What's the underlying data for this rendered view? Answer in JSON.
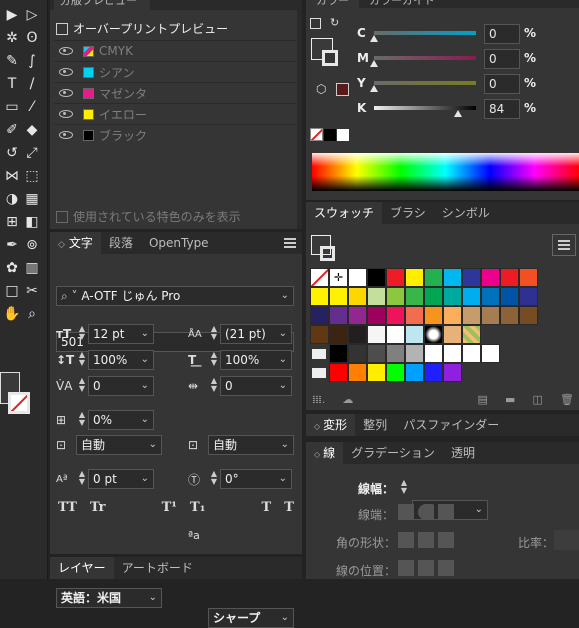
{
  "toolbar": {
    "tools": [
      "selection-tool",
      "direct-selection-tool",
      "magic-wand-tool",
      "lasso-tool",
      "pen-tool",
      "curvature-tool",
      "type-tool",
      "line-tool",
      "rectangle-tool",
      "paintbrush-tool",
      "shaper-tool",
      "eraser-tool",
      "rotate-tool",
      "scale-tool",
      "width-tool",
      "free-transform-tool",
      "shape-builder-tool",
      "perspective-grid-tool",
      "mesh-tool",
      "gradient-tool",
      "eyedropper-tool",
      "blend-tool",
      "symbol-sprayer-tool",
      "column-graph-tool",
      "artboard-tool",
      "slice-tool",
      "hand-tool",
      "zoom-tool"
    ]
  },
  "separations": {
    "tab_label": "分版プレビュー",
    "overprint_label": "オーバープリントプレビュー",
    "plates": [
      {
        "name": "CMYK",
        "color": "cmyk"
      },
      {
        "name": "シアン",
        "color": "#00d2f0"
      },
      {
        "name": "マゼンタ",
        "color": "#e8198b"
      },
      {
        "name": "イエロー",
        "color": "#ffee00"
      },
      {
        "name": "ブラック",
        "color": "#000000"
      }
    ],
    "spot_only_label": "使用されている特色のみを表示"
  },
  "character": {
    "tabs": [
      "文字",
      "段落",
      "OpenType"
    ],
    "font_family": "A-OTF じゅん Pro",
    "font_style": "501",
    "font_size": "12 pt",
    "leading": "(21 pt)",
    "vertical_scale": "100%",
    "horizontal_scale": "100%",
    "kerning": "0",
    "tracking": "0",
    "tsume": "0%",
    "aki_left": "自動",
    "aki_right": "自動",
    "baseline_shift": "0 pt",
    "rotation": "0°",
    "type_buttons": [
      "TT",
      "Tr",
      "T¹",
      "T₁",
      "T",
      "T"
    ],
    "language": "英語：米国",
    "antialias_icon": "ªa",
    "antialias": "シャープ"
  },
  "bottom_tabs": [
    "レイヤー",
    "アートボード"
  ],
  "color": {
    "tabs": [
      "カラー",
      "カラーガイド"
    ],
    "channels": [
      {
        "name": "C",
        "value": "0",
        "level": 0.0
      },
      {
        "name": "M",
        "value": "0",
        "level": 0.0
      },
      {
        "name": "Y",
        "value": "0",
        "level": 0.0
      },
      {
        "name": "K",
        "value": "84",
        "level": 0.84
      }
    ],
    "percent": "%"
  },
  "swatches": {
    "tabs": [
      "スウォッチ",
      "ブラシ",
      "シンボル"
    ],
    "grid": [
      [
        "none",
        "reg",
        "#ffffff",
        "#000000",
        "#ee1c25",
        "#ffee00",
        "#22b14c",
        "#00b7ef",
        "#2f3699",
        "#ec008c",
        "#ed1c24",
        "#f25022"
      ],
      [
        "#fff200",
        "#fff200",
        "#ffd700",
        "#c4df9b",
        "#8dc63f",
        "#39b54a",
        "#00a651",
        "#00a99d",
        "#00aeef",
        "#0072bc",
        "#0054a6",
        "#2e3192"
      ],
      [
        "#262262",
        "#662d91",
        "#92278f",
        "#9e005d",
        "#ed145b",
        "#f26c4f",
        "#f7941d",
        "#fbaf5d",
        "#c69c6d",
        "#a67c52",
        "#8c6239",
        "#754c24"
      ],
      [
        "#603913",
        "#3c2415",
        "#231f20",
        "#f5f5f5",
        "#ffffff",
        "#bfe6f0",
        "radial",
        "#e6b27a",
        "pattern",
        "",
        "",
        ""
      ],
      [
        "folder",
        "#000000",
        "#333333",
        "#4d4d4d",
        "#808080",
        "#b3b3b3",
        "#ffffff",
        "#ffffff",
        "#ffffff",
        "#ffffff",
        "",
        ""
      ],
      [
        "folder",
        "#ff0000",
        "#ff7f00",
        "#ffee00",
        "#00ff00",
        "#00a0ff",
        "#2020ff",
        "#9020e0",
        "",
        "",
        "",
        ""
      ]
    ]
  },
  "transform": {
    "tabs": [
      "変形",
      "整列",
      "パスファインダー"
    ]
  },
  "stroke": {
    "tabs": [
      "線",
      "グラデーション",
      "透明"
    ],
    "weight_label": "線幅：",
    "cap_label": "線端：",
    "corner_label": "角の形状：",
    "limit_label": "比率：",
    "align_label": "線の位置："
  }
}
